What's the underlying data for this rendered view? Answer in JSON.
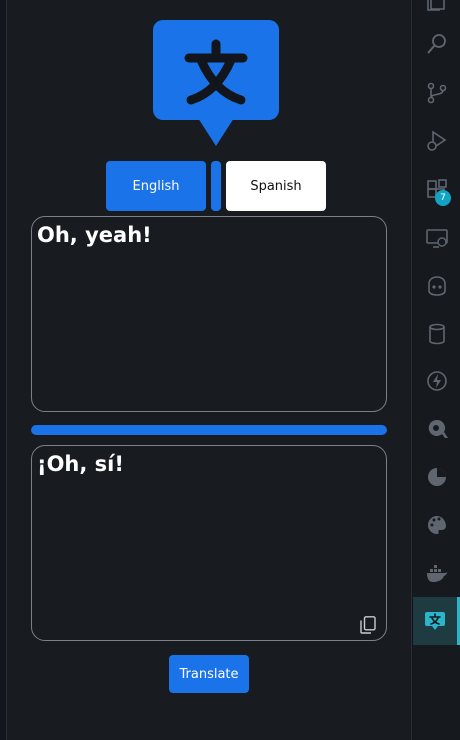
{
  "app": {
    "accent": "#1a73e8",
    "background": "#181c21"
  },
  "languages": {
    "source": "English",
    "target": "Spanish"
  },
  "source_text": "Oh, yeah!",
  "target_text": "¡Oh, sí!",
  "progress": 1.0,
  "translate_label": "Translate",
  "activity_bar": {
    "items": [
      {
        "icon": "explorer-icon"
      },
      {
        "icon": "search-icon"
      },
      {
        "icon": "source-control-icon"
      },
      {
        "icon": "run-debug-icon"
      },
      {
        "icon": "extensions-icon",
        "badge": "7"
      },
      {
        "icon": "remote-explorer-icon"
      },
      {
        "icon": "github-copilot-icon"
      },
      {
        "icon": "database-icon"
      },
      {
        "icon": "thunder-client-icon"
      },
      {
        "icon": "quokka-icon"
      },
      {
        "icon": "pie-chart-icon"
      },
      {
        "icon": "palette-icon"
      },
      {
        "icon": "docker-icon"
      },
      {
        "icon": "translate-icon"
      }
    ]
  }
}
